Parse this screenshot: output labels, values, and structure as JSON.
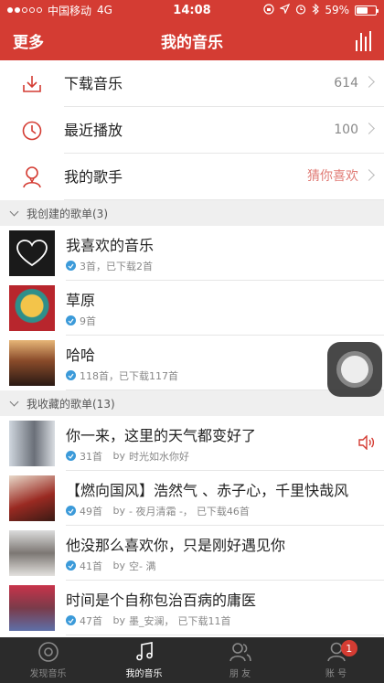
{
  "status_bar": {
    "carrier": "中国移动",
    "network": "4G",
    "time": "14:08",
    "battery": "59%",
    "battery_level": 0.59
  },
  "header": {
    "more_label": "更多",
    "title": "我的音乐"
  },
  "quick_items": [
    {
      "label": "下载音乐",
      "value": "614",
      "icon": "download-icon"
    },
    {
      "label": "最近播放",
      "value": "100",
      "icon": "clock-icon"
    },
    {
      "label": "我的歌手",
      "value": "猜你喜欢",
      "icon": "person-icon"
    }
  ],
  "created_section": {
    "title": "我创建的歌单(3)"
  },
  "created_playlists": [
    {
      "title": "我喜欢的音乐",
      "sub": "3首，已下载2首"
    },
    {
      "title": "草原",
      "sub": "9首"
    },
    {
      "title": "哈哈",
      "sub": "118首，已下载117首"
    }
  ],
  "collected_section": {
    "title": "我收藏的歌单(13)"
  },
  "collected_playlists": [
    {
      "title": "你一来，这里的天气都变好了",
      "count": "31首",
      "by": "by",
      "author": "时光如水你好",
      "extra": ""
    },
    {
      "title": "【燃向国风】浩然气 、赤子心，千里快哉风",
      "count": "49首",
      "by": "by",
      "author": "- 夜月清霜 -，",
      "extra": "已下载46首"
    },
    {
      "title": "他没那么喜欢你，只是刚好遇见你",
      "count": "41首",
      "by": "by",
      "author": "空- 满",
      "extra": ""
    },
    {
      "title": "时间是个自称包治百病的庸医",
      "count": "47首",
      "by": "by",
      "author": "墨_安澜，",
      "extra": "已下载11首"
    }
  ],
  "tabbar": {
    "tabs": [
      {
        "label": "发现音乐",
        "icon": "discover-icon"
      },
      {
        "label": "我的音乐",
        "icon": "music-note-icon"
      },
      {
        "label": "朋 友",
        "icon": "friends-icon"
      },
      {
        "label": "账 号",
        "icon": "account-icon"
      }
    ],
    "account_badge": "1"
  },
  "colors": {
    "brand_red": "#d43c33",
    "tabbar_bg": "#2b2b2b",
    "check_blue": "#3b9ad9"
  }
}
